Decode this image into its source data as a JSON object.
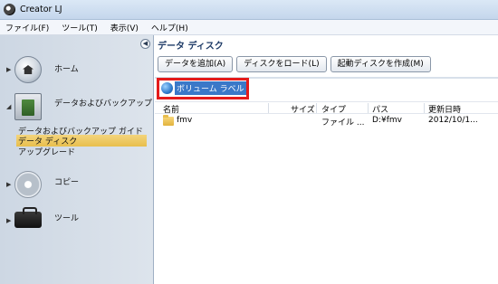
{
  "window": {
    "title": "Creator LJ"
  },
  "menu": [
    {
      "label": "ファイル(F)"
    },
    {
      "label": "ツール(T)"
    },
    {
      "label": "表示(V)"
    },
    {
      "label": "ヘルプ(H)"
    }
  ],
  "sidebar": {
    "sections": [
      {
        "label": "ホーム",
        "icon": "home-icon"
      },
      {
        "label": "データおよびバックアップ",
        "icon": "backup-icon",
        "sub_items": [
          {
            "label": "データおよびバックアップ ガイド"
          },
          {
            "label": "データ ディスク",
            "selected": true
          },
          {
            "label": "アップグレード"
          }
        ]
      },
      {
        "label": "コピー",
        "icon": "copy-icon"
      },
      {
        "label": "ツール",
        "icon": "toolbox-icon"
      }
    ]
  },
  "main": {
    "title": "データ ディスク",
    "buttons": [
      {
        "label": "データを追加(A)"
      },
      {
        "label": "ディスクをロード(L)"
      },
      {
        "label": "起動ディスクを作成(M)"
      }
    ],
    "volume_label": "ボリューム ラベル",
    "columns": [
      "名前",
      "サイズ",
      "タイプ",
      "パス",
      "更新日時"
    ],
    "rows": [
      {
        "name": "fmv",
        "size": "",
        "type": "ファイル ...",
        "path": "D:¥fmv",
        "modified": "2012/10/1..."
      }
    ]
  },
  "colors": {
    "highlight_border": "#e41b1b",
    "selection": "#3a78c8",
    "selected_item": "#e8bf4d"
  }
}
